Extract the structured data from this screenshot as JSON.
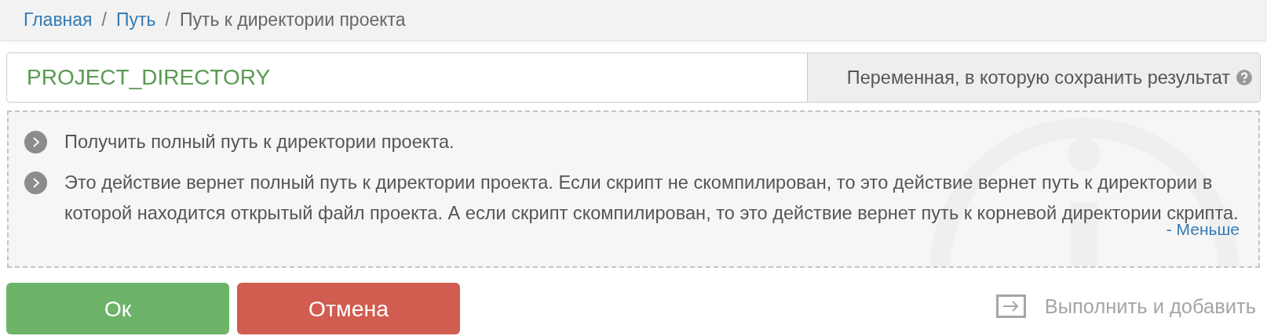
{
  "breadcrumb": [
    {
      "label": "Главная",
      "kind": "link"
    },
    {
      "label": "Путь",
      "kind": "link",
      "separator": "/"
    },
    {
      "label": "Путь к директории проекта",
      "kind": "current",
      "separator": "/"
    }
  ],
  "variable_field": {
    "value": "PROJECT_DIRECTORY",
    "label": "Переменная, в которую сохранить результат"
  },
  "description": {
    "items": [
      "Получить полный путь к директории проекта.",
      "Это действие вернет полный путь к директории проекта. Если скрипт не скомпилирован, то это действие вернет путь к директории в которой находится открытый файл проекта. А если скрипт скомпилирован, то это действие вернет путь к корневой директории скрипта."
    ],
    "toggle": "- Меньше"
  },
  "buttons": [
    {
      "label": "Ок",
      "kind": "ok"
    },
    {
      "label": "Отмена",
      "kind": "cancel"
    }
  ],
  "run_and_add": {
    "label": "Выполнить и добавить",
    "disabled": true
  }
}
